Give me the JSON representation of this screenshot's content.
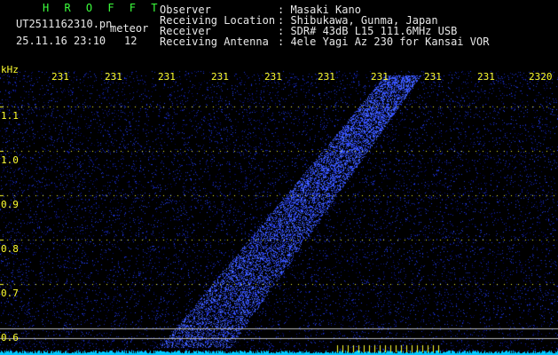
{
  "header": {
    "app_name": "H R O F F T",
    "filename": "UT2511162310.pn",
    "mode": "meteor",
    "datetime": "25.11.16 23:10",
    "count": "12",
    "info": [
      {
        "label": "Observer",
        "value": ": Masaki Kano"
      },
      {
        "label": "Receiving Location",
        "value": ": Shibukawa, Gunma, Japan"
      },
      {
        "label": "Receiver",
        "value": ": SDR# 43dB L15 111.6MHz USB"
      },
      {
        "label": "Receiving Antenna",
        "value": ": 4ele Yagi Az 230 for Kansai VOR"
      }
    ]
  },
  "axes": {
    "y_unit": "kHz",
    "y_ticks": [
      "1.1",
      "1.0",
      "0.9",
      "0.8",
      "0.7",
      "0.6"
    ],
    "x_ticks": [
      "231",
      "231",
      "231",
      "231",
      "231",
      "231",
      "231",
      "231",
      "231",
      "2320"
    ]
  },
  "colors": {
    "background": "#000000",
    "text": "#e8e8e8",
    "title": "#3cff3c",
    "axis": "#ffff30",
    "noise": "#1e3cff",
    "baseline": "#00c8ff"
  }
}
